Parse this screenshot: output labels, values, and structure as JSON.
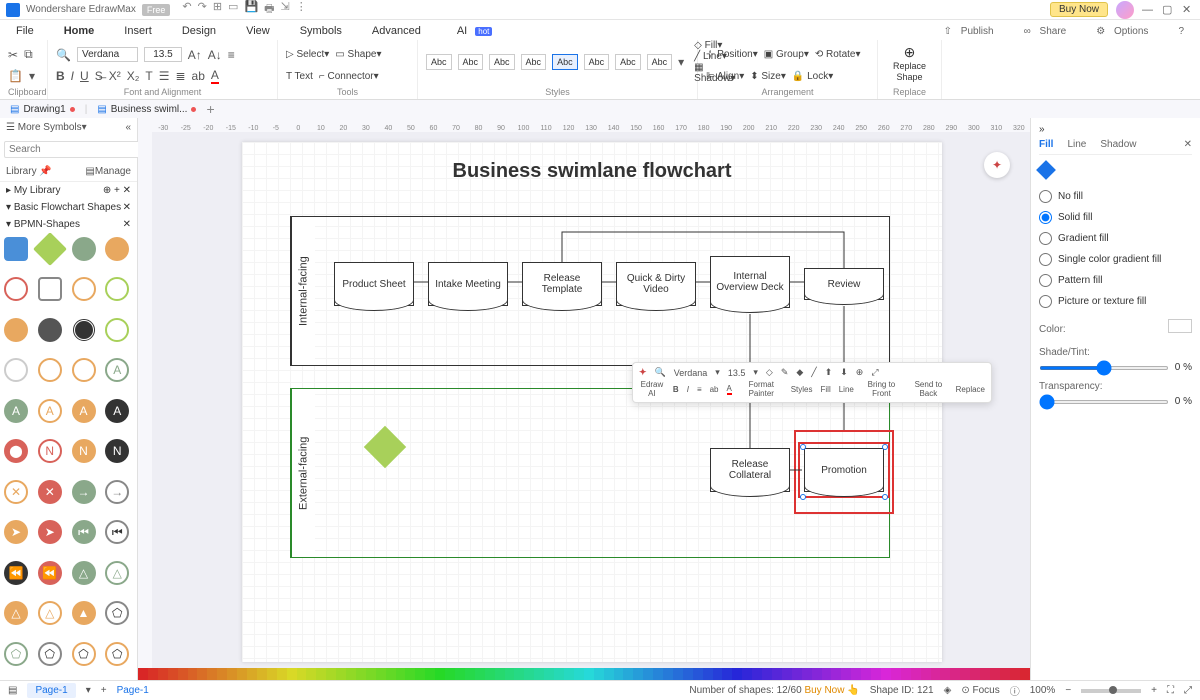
{
  "app": {
    "name": "Wondershare EdrawMax",
    "badge": "Free"
  },
  "titlebar": {
    "buynow": "Buy Now"
  },
  "menu": {
    "items": [
      "File",
      "Home",
      "Insert",
      "Design",
      "View",
      "Symbols",
      "Advanced",
      "AI"
    ],
    "active": 1,
    "right": [
      "Publish",
      "Share",
      "Options"
    ]
  },
  "ribbon": {
    "clipboard": "Clipboard",
    "font": "Font and Alignment",
    "fontname": "Verdana",
    "fontsize": "13.5",
    "tools": "Tools",
    "select": "Select",
    "shape": "Shape",
    "text": "Text",
    "connector": "Connector",
    "styles": "Styles",
    "abc": "Abc",
    "fill": "Fill",
    "line": "Line",
    "shadow": "Shadow",
    "arrangement": "Arrangement",
    "position": "Position",
    "align": "Align",
    "group": "Group",
    "size": "Size",
    "rotate": "Rotate",
    "lock": "Lock",
    "replace": "Replace",
    "reshape": "Replace\nShape"
  },
  "doctabs": {
    "t1": "Drawing1",
    "t2": "Business swiml..."
  },
  "left": {
    "more": "More Symbols",
    "search_ph": "Search",
    "search_btn": "Search",
    "library": "Library",
    "manage": "Manage",
    "mylib": "My Library",
    "cat1": "Basic Flowchart Shapes",
    "cat2": "BPMN-Shapes"
  },
  "canvas": {
    "title": "Business swimlane flowchart",
    "lane1": "Internal-facing",
    "lane2": "External-facing",
    "b1": "Product Sheet",
    "b2": "Intake Meeting",
    "b3": "Release Template",
    "b4": "Quick & Dirty Video",
    "b5": "Internal Overview Deck",
    "b6": "Review",
    "b7": "Release Collateral",
    "b8": "Promotion"
  },
  "float": {
    "ai": "Edraw AI",
    "font": "Verdana",
    "size": "13.5",
    "format": "Format Painter",
    "styles": "Styles",
    "fill": "Fill",
    "line": "Line",
    "front": "Bring to Front",
    "back": "Send to Back",
    "replace": "Replace"
  },
  "right": {
    "tab_fill": "Fill",
    "tab_line": "Line",
    "tab_shadow": "Shadow",
    "nofill": "No fill",
    "solid": "Solid fill",
    "gradient": "Gradient fill",
    "single": "Single color gradient fill",
    "pattern": "Pattern fill",
    "picture": "Picture or texture fill",
    "color": "Color:",
    "shade": "Shade/Tint:",
    "shade_val": "0 %",
    "transparency": "Transparency:",
    "trans_val": "0 %"
  },
  "status": {
    "page": "Page-1",
    "page2": "Page-1",
    "shapes": "Number of shapes: 12/60",
    "buy": "Buy Now",
    "shapeid": "Shape ID: 121",
    "focus": "Focus",
    "zoom": "100%"
  },
  "ruler": [
    "-30",
    "-25",
    "-20",
    "-15",
    "-10",
    "-5",
    "0",
    "10",
    "20",
    "30",
    "40",
    "50",
    "60",
    "70",
    "80",
    "90",
    "100",
    "110",
    "120",
    "130",
    "140",
    "150",
    "160",
    "170",
    "180",
    "190",
    "200",
    "210",
    "220",
    "230",
    "240",
    "250",
    "260",
    "270",
    "280",
    "290",
    "300",
    "310",
    "320"
  ]
}
